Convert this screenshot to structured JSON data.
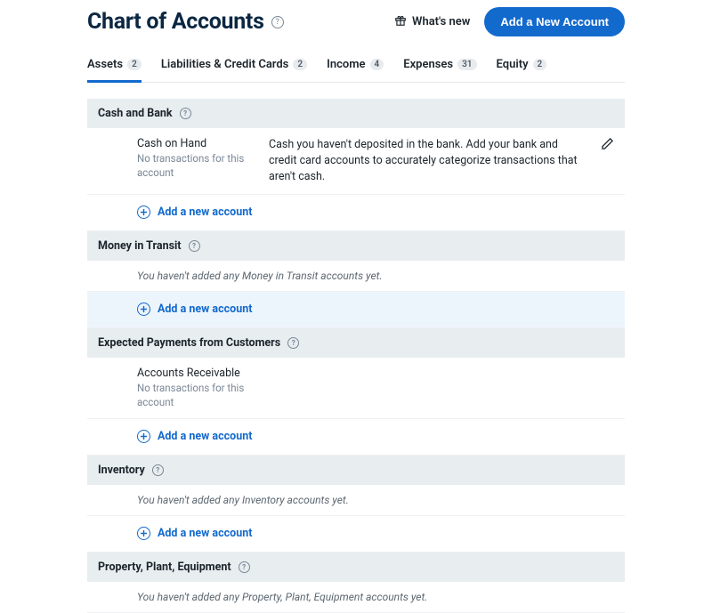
{
  "header": {
    "title": "Chart of Accounts",
    "whats_new": "What's new",
    "add_account": "Add a New Account"
  },
  "tabs": [
    {
      "label": "Assets",
      "count": "2",
      "active": true
    },
    {
      "label": "Liabilities & Credit Cards",
      "count": "2",
      "active": false
    },
    {
      "label": "Income",
      "count": "4",
      "active": false
    },
    {
      "label": "Expenses",
      "count": "31",
      "active": false
    },
    {
      "label": "Equity",
      "count": "2",
      "active": false
    }
  ],
  "add_label": "Add a new account",
  "no_tx": "No transactions for this account",
  "sections": [
    {
      "title": "Cash and Bank",
      "accounts": [
        {
          "name": "Cash on Hand",
          "desc": "Cash you haven't deposited in the bank. Add your bank and credit card accounts to accurately categorize transactions that aren't cash.",
          "editable": true
        }
      ],
      "empty": null,
      "highlight_add": false
    },
    {
      "title": "Money in Transit",
      "accounts": [],
      "empty": "You haven't added any Money in Transit accounts yet.",
      "highlight_add": true
    },
    {
      "title": "Expected Payments from Customers",
      "accounts": [
        {
          "name": "Accounts Receivable",
          "desc": "",
          "editable": false
        }
      ],
      "empty": null,
      "highlight_add": false
    },
    {
      "title": "Inventory",
      "accounts": [],
      "empty": "You haven't added any Inventory accounts yet.",
      "highlight_add": false
    },
    {
      "title": "Property, Plant, Equipment",
      "accounts": [],
      "empty": "You haven't added any Property, Plant, Equipment accounts yet.",
      "highlight_add": false,
      "hide_add": true
    }
  ]
}
